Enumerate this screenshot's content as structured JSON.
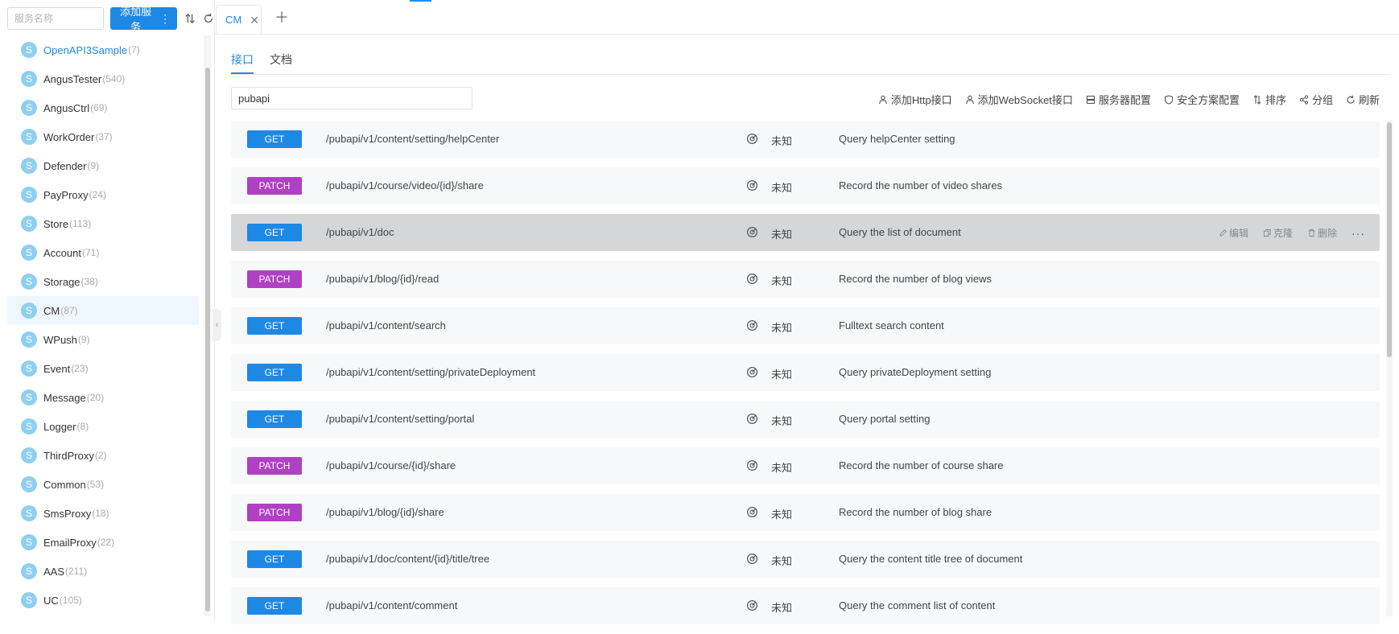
{
  "sidebar": {
    "search_placeholder": "服务名称",
    "add_service_label": "添加服务",
    "services": [
      {
        "badge": "S",
        "name": "OpenAPI3Sample",
        "count": "(7)"
      },
      {
        "badge": "S",
        "name": "AngusTester",
        "count": "(540)"
      },
      {
        "badge": "S",
        "name": "AngusCtrl",
        "count": "(69)"
      },
      {
        "badge": "S",
        "name": "WorkOrder",
        "count": "(37)"
      },
      {
        "badge": "S",
        "name": "Defender",
        "count": "(9)"
      },
      {
        "badge": "S",
        "name": "PayProxy",
        "count": "(24)"
      },
      {
        "badge": "S",
        "name": "Store",
        "count": "(113)"
      },
      {
        "badge": "S",
        "name": "Account",
        "count": "(71)"
      },
      {
        "badge": "S",
        "name": "Storage",
        "count": "(38)"
      },
      {
        "badge": "S",
        "name": "CM",
        "count": "(87)"
      },
      {
        "badge": "S",
        "name": "WPush",
        "count": "(9)"
      },
      {
        "badge": "S",
        "name": "Event",
        "count": "(23)"
      },
      {
        "badge": "S",
        "name": "Message",
        "count": "(20)"
      },
      {
        "badge": "S",
        "name": "Logger",
        "count": "(8)"
      },
      {
        "badge": "S",
        "name": "ThirdProxy",
        "count": "(2)"
      },
      {
        "badge": "S",
        "name": "Common",
        "count": "(53)"
      },
      {
        "badge": "S",
        "name": "SmsProxy",
        "count": "(18)"
      },
      {
        "badge": "S",
        "name": "EmailProxy",
        "count": "(22)"
      },
      {
        "badge": "S",
        "name": "AAS",
        "count": "(211)"
      },
      {
        "badge": "S",
        "name": "UC",
        "count": "(105)"
      }
    ]
  },
  "tabs": {
    "active_label": "CM",
    "close_glyph": "✕",
    "add_glyph": "＋"
  },
  "subtabs": {
    "api": "接口",
    "doc": "文档"
  },
  "filter": {
    "value": "pubapi"
  },
  "actions": {
    "add_http": "添加Http接口",
    "add_websocket": "添加WebSocket接口",
    "server_config": "服务器配置",
    "security_config": "安全方案配置",
    "sort": "排序",
    "group": "分组",
    "refresh": "刷新"
  },
  "row_actions": {
    "edit": "编辑",
    "clone": "克隆",
    "delete": "删除",
    "more": "···"
  },
  "apis": [
    {
      "method": "GET",
      "path": "/pubapi/v1/content/setting/helpCenter",
      "status": "未知",
      "desc": "Query helpCenter setting"
    },
    {
      "method": "PATCH",
      "path": "/pubapi/v1/course/video/{id}/share",
      "status": "未知",
      "desc": "Record the number of video shares"
    },
    {
      "method": "GET",
      "path": "/pubapi/v1/doc",
      "status": "未知",
      "desc": "Query the list of document"
    },
    {
      "method": "PATCH",
      "path": "/pubapi/v1/blog/{id}/read",
      "status": "未知",
      "desc": "Record the number of blog views"
    },
    {
      "method": "GET",
      "path": "/pubapi/v1/content/search",
      "status": "未知",
      "desc": "Fulltext search content"
    },
    {
      "method": "GET",
      "path": "/pubapi/v1/content/setting/privateDeployment",
      "status": "未知",
      "desc": "Query privateDeployment setting"
    },
    {
      "method": "GET",
      "path": "/pubapi/v1/content/setting/portal",
      "status": "未知",
      "desc": "Query portal setting"
    },
    {
      "method": "PATCH",
      "path": "/pubapi/v1/course/{id}/share",
      "status": "未知",
      "desc": "Record the number of course share"
    },
    {
      "method": "PATCH",
      "path": "/pubapi/v1/blog/{id}/share",
      "status": "未知",
      "desc": "Record the number of blog share"
    },
    {
      "method": "GET",
      "path": "/pubapi/v1/doc/content/{id}/title/tree",
      "status": "未知",
      "desc": "Query the content title tree of document"
    },
    {
      "method": "GET",
      "path": "/pubapi/v1/content/comment",
      "status": "未知",
      "desc": "Query the comment list of content"
    }
  ]
}
